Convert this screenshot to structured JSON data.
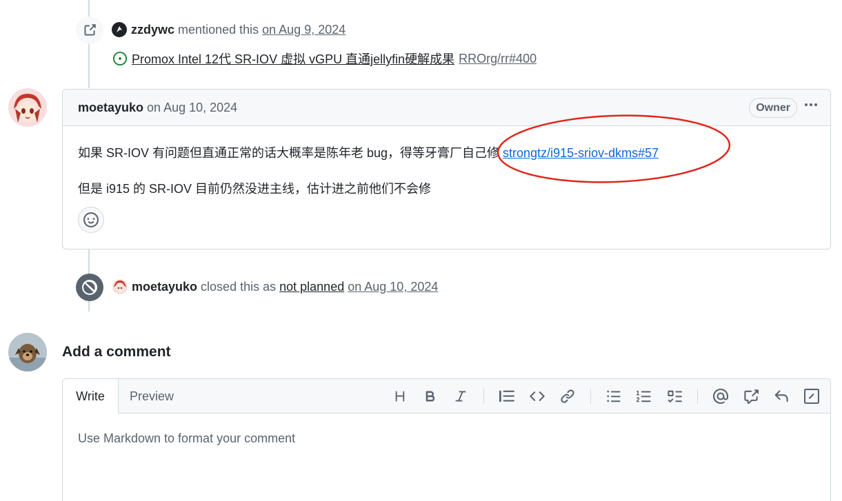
{
  "mention_event": {
    "user": "zzdywc",
    "action": "mentioned this",
    "date": "on Aug 9, 2024",
    "ref_title": "Promox Intel 12代 SR-IOV 虚拟 vGPU 直通jellyfin硬解成果",
    "ref_repo": "RROrg/rr#400"
  },
  "comment": {
    "author": "moetayuko",
    "date": "on Aug 10, 2024",
    "badge": "Owner",
    "line1_text": "如果 SR-IOV 有问题但直通正常的话大概率是陈年老 bug，得等牙膏厂自己修 ",
    "line1_link": "strongtz/i915-sriov-dkms#57",
    "line2_text": "但是 i915 的 SR-IOV 目前仍然没进主线，估计进之前他们不会修"
  },
  "close_event": {
    "user": "moetayuko",
    "action": "closed this as",
    "reason": "not planned",
    "date": "on Aug 10, 2024"
  },
  "add_comment": {
    "heading": "Add a comment",
    "tab_write": "Write",
    "tab_preview": "Preview",
    "placeholder": "Use Markdown to format your comment"
  },
  "colors": {
    "accent_link": "#0969da",
    "open_green": "#1a7f37",
    "closed_gray": "#59636e",
    "annotation_red": "#e0251b"
  }
}
